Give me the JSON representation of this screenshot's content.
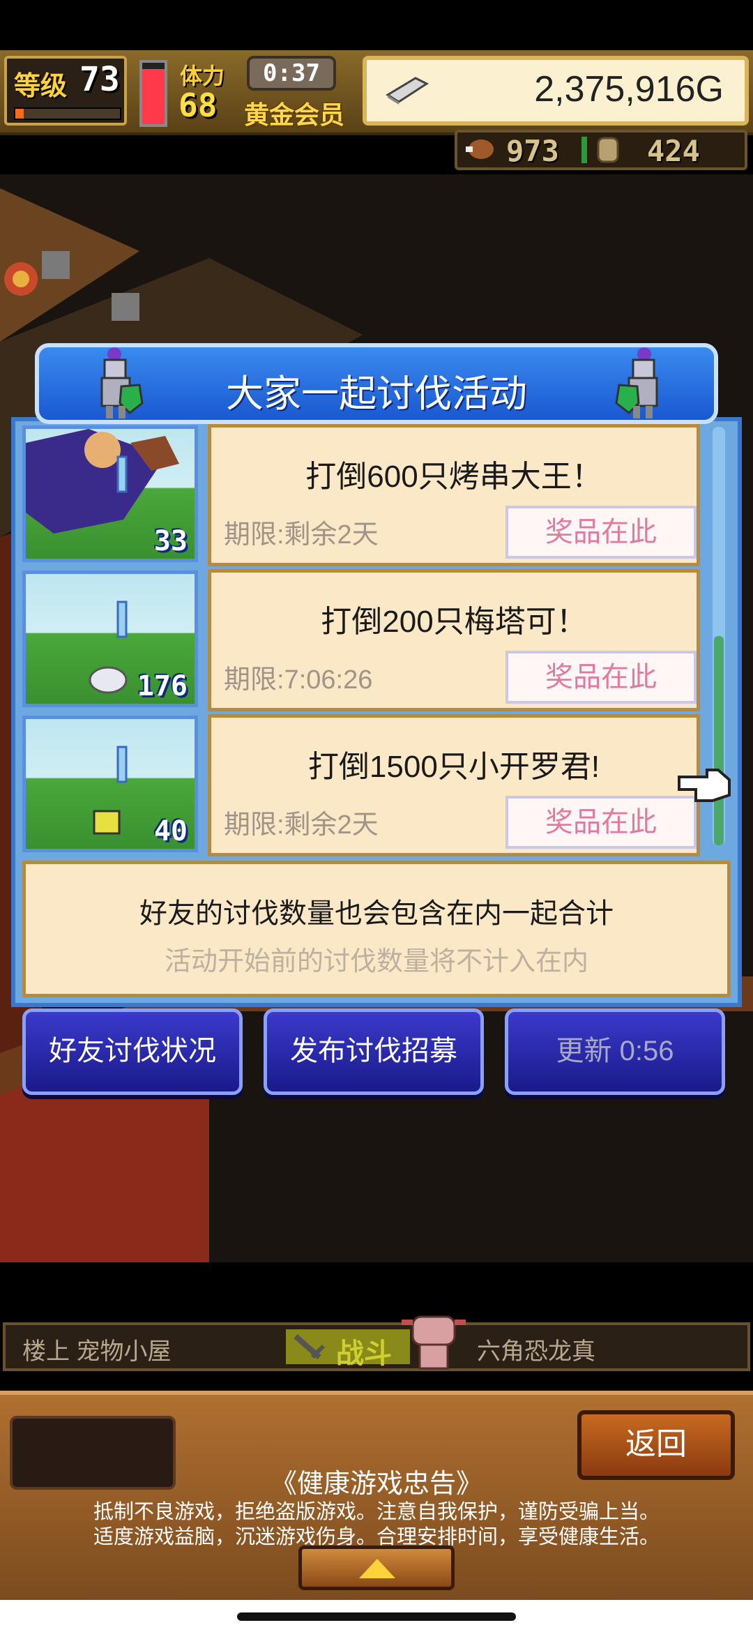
{
  "hud": {
    "level_label": "等级",
    "level": "73",
    "level_progress": 0.08,
    "hp_fill": 0.9,
    "stamina_label": "体力",
    "stamina": "68",
    "timer": "0:37",
    "member_label": "黄金会员",
    "money": "2,375,916G",
    "currency_a": "973",
    "currency_b": "424"
  },
  "dialog": {
    "title": "大家一起讨伐活动",
    "rows": [
      {
        "badge": "33",
        "title": "打倒600只烤串大王！",
        "time": "期限:剩余2天",
        "prize": "奖品在此"
      },
      {
        "badge": "176",
        "title": "打倒200只梅塔可！",
        "time": "期限:7:06:26",
        "prize": "奖品在此"
      },
      {
        "badge": "40",
        "title": "打倒1500只小开罗君!",
        "time": "期限:剩余2天",
        "prize": "奖品在此"
      }
    ],
    "note_line1": "好友的讨伐数量也会包含在内一起合计",
    "note_line2": "活动开始前的讨伐数量将不计入在内",
    "buttons": {
      "friend_status": "好友讨伐状况",
      "post_recruit": "发布讨伐招募",
      "refresh": "更新 0:56"
    }
  },
  "status_bar": {
    "floor": "楼上 宠物小屋",
    "battle": "战斗",
    "pet": "六角恐龙真"
  },
  "bottom": {
    "back": "返回",
    "notice_title": "《健康游戏忠告》",
    "notice_line1": "抵制不良游戏，拒绝盗版游戏。注意自我保护，谨防受骗上当。",
    "notice_line2": "适度游戏益脑，沉迷游戏伤身。合理安排时间，享受健康生活。"
  },
  "colors": {
    "accent_blue": "#1a58d0",
    "card_bg": "#fbe8c6",
    "prize_text": "#e07aa0",
    "gold": "#ffd23a"
  }
}
